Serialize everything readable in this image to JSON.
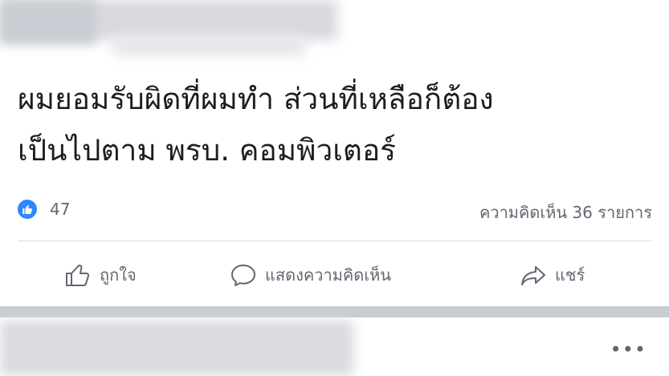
{
  "post": {
    "text_line_1": "ผมยอมรับผิดที่ผมทำ ส่วนที่เหลือก็ต้อง",
    "text_line_2": "เป็นไปตาม พรบ. คอมพิวเตอร์"
  },
  "stats": {
    "like_count": "47",
    "comments": "ความคิดเห็น 36 รายการ"
  },
  "actions": {
    "like_label": "ถูกใจ",
    "comment_label": "แสดงความคิดเห็น",
    "share_label": "แชร์"
  },
  "more_menu": "•••",
  "colors": {
    "accent": "#2d88ff",
    "secondary_text": "#606770",
    "divider": "#dadde1"
  },
  "icons": [
    "like-badge-icon",
    "thumbs-up-icon",
    "comment-bubble-icon",
    "share-arrow-icon",
    "more-icon"
  ]
}
